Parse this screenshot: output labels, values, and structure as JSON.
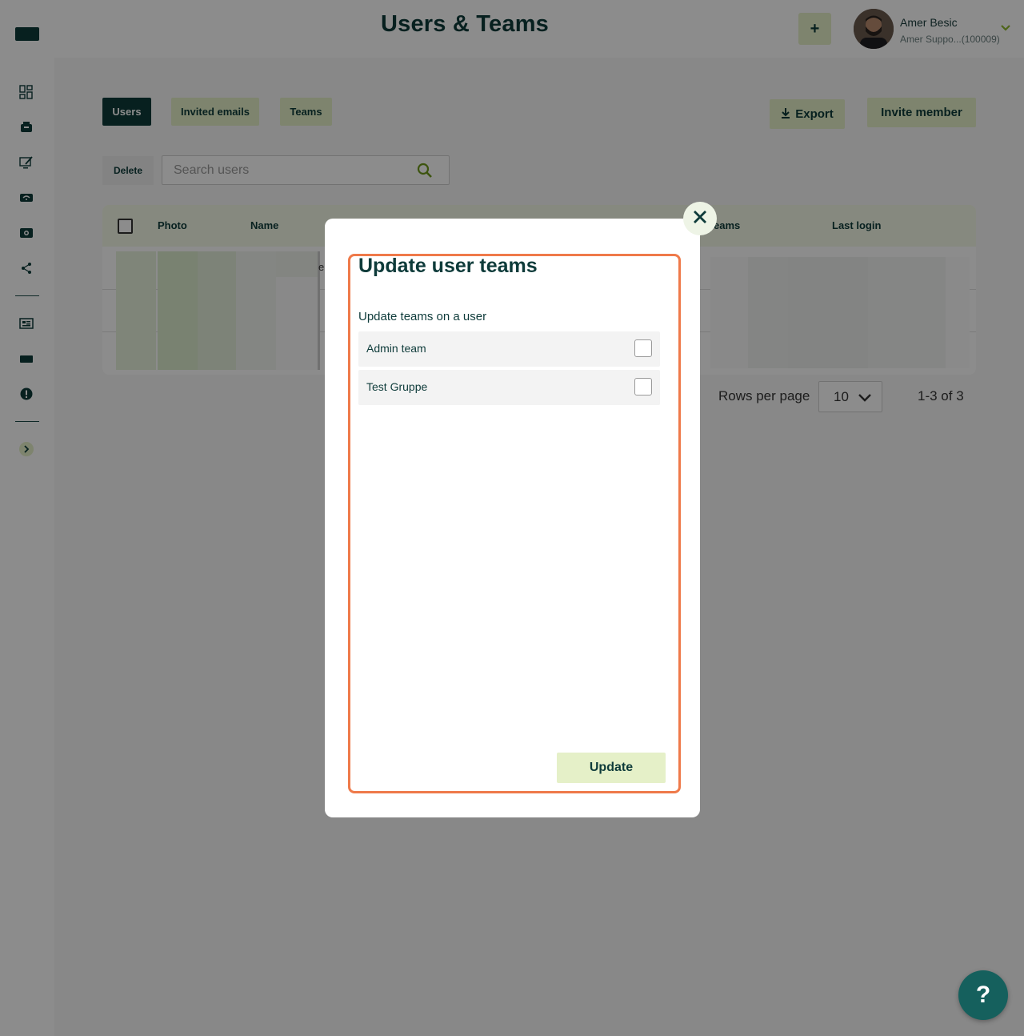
{
  "header": {
    "title": "Users & Teams",
    "add_label": "+",
    "user_name": "Amer Besic",
    "user_sub": "Amer Suppo...(100009)"
  },
  "tabs": [
    {
      "label": "Users"
    },
    {
      "label": "Invited emails"
    },
    {
      "label": "Teams"
    }
  ],
  "actions": {
    "export_label": "Export",
    "invite_label": "Invite member",
    "delete_label": "Delete"
  },
  "search": {
    "placeholder": "Search users"
  },
  "table": {
    "columns": [
      "Photo",
      "Name",
      "eams",
      "Last login"
    ],
    "partial_cell_text": "e"
  },
  "pagination": {
    "rows_label": "Rows per page",
    "rows_value": "10",
    "range": "1-3 of 3"
  },
  "modal": {
    "title": "Update user teams",
    "subtitle": "Update teams on a user",
    "teams": [
      {
        "label": "Admin team",
        "checked": false
      },
      {
        "label": "Test Gruppe",
        "checked": false
      }
    ],
    "update_label": "Update"
  },
  "help": {
    "label": "?"
  },
  "colors": {
    "brand_dark": "#0e3b3a",
    "accent_light": "#e5f0c8",
    "highlight_frame": "#ef7a4a",
    "help_button": "#15605d"
  },
  "icons": {
    "sidebar": [
      "dashboard-icon",
      "inbox-icon",
      "edit-screen-icon",
      "wifi-device-icon",
      "camera-icon",
      "share-icon",
      "monitor-list-icon",
      "display-icon",
      "alert-icon",
      "expand-chevron-icon"
    ]
  }
}
